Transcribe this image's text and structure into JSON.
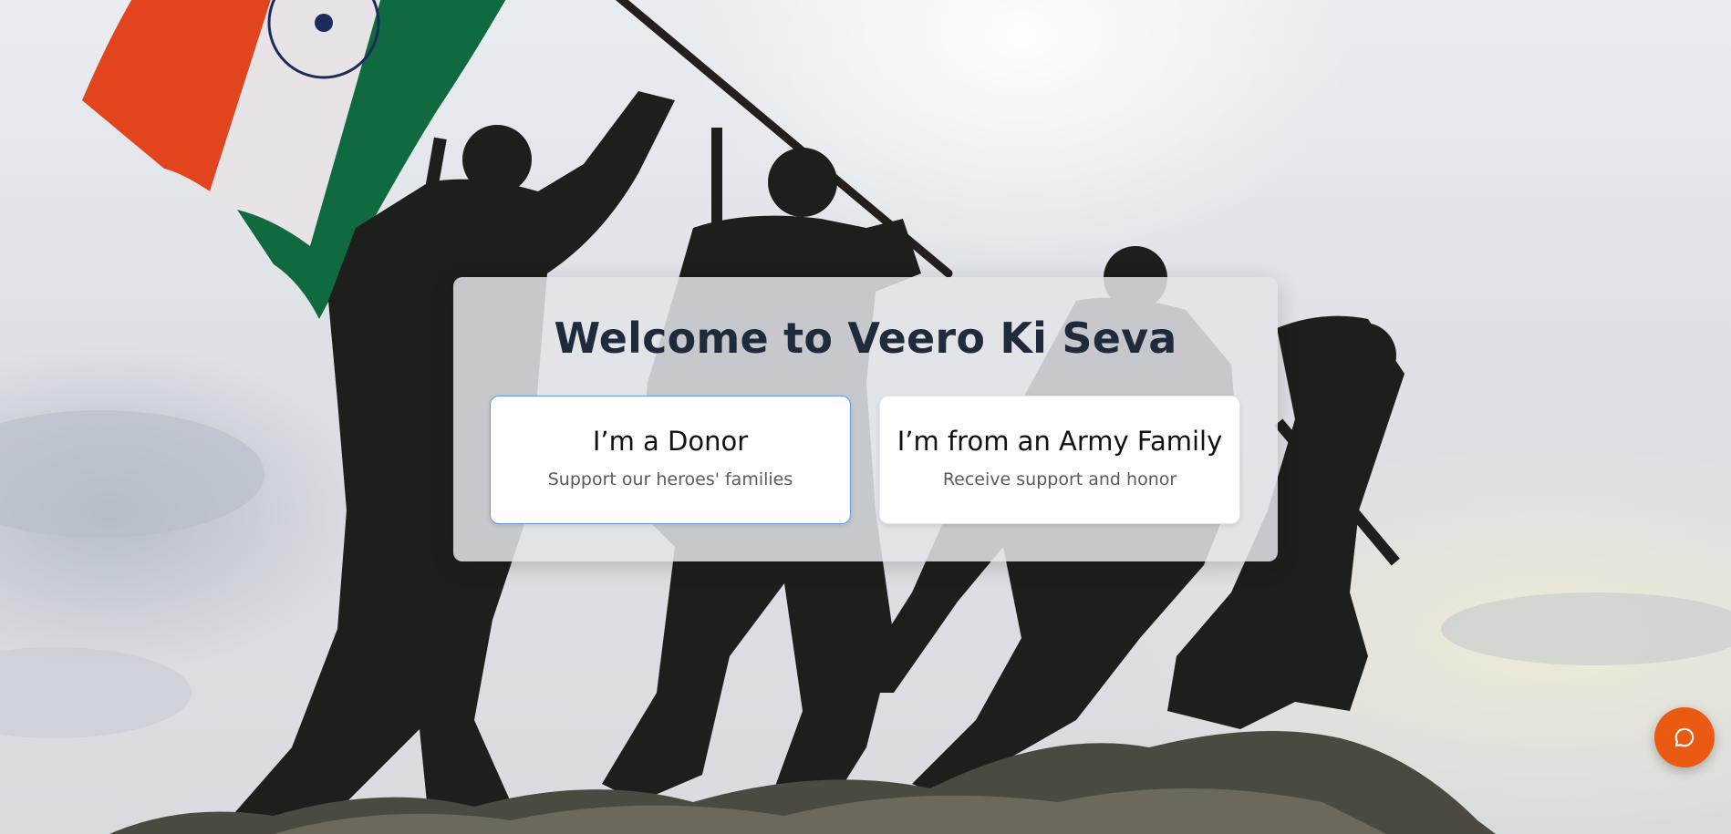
{
  "hero": {
    "title": "Welcome to Veero Ki Seva"
  },
  "options": [
    {
      "title": "I’m a Donor",
      "subtitle": "Support our heroes' families",
      "selected": true
    },
    {
      "title": "I’m from an Army Family",
      "subtitle": "Receive support and honor",
      "selected": false
    }
  ],
  "chat": {
    "icon": "chat-bubble-icon"
  },
  "colors": {
    "accent": "#ea5a12",
    "selected_border": "#6a97e6",
    "title_text": "#1f2a3c",
    "flag_saffron": "#e2451e",
    "flag_white": "#e8e4e6",
    "flag_green": "#0f6b3f",
    "statue": "#1d1f1d"
  }
}
